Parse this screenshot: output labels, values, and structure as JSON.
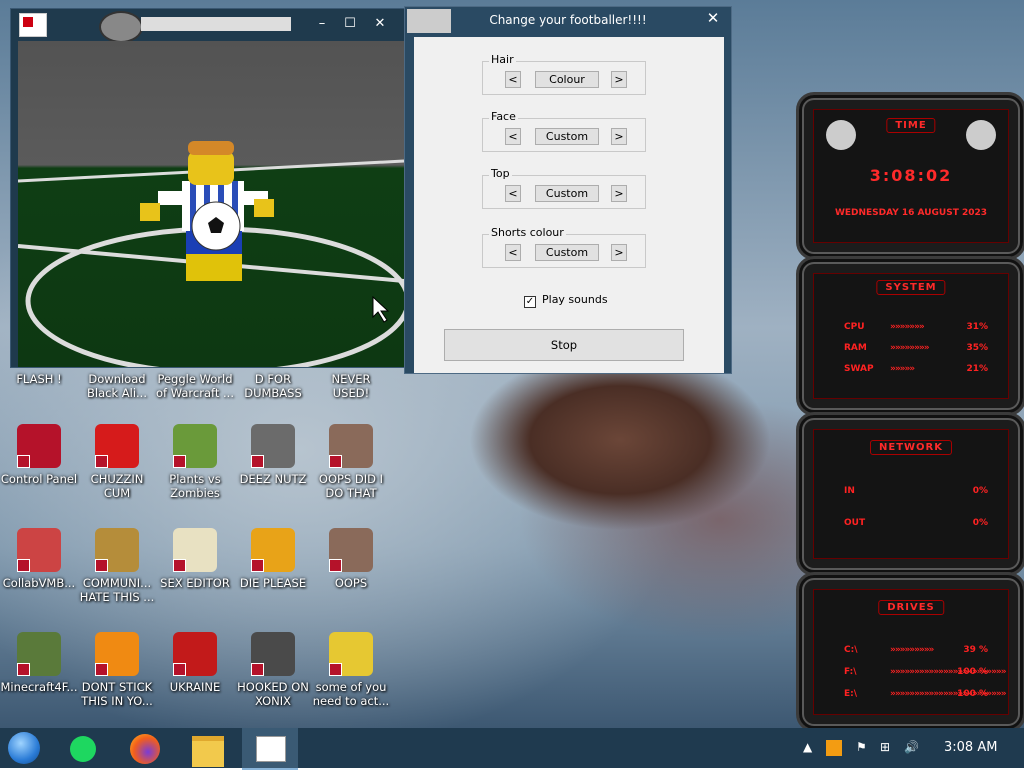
{
  "dialog": {
    "title": "Change your footballer!!!!",
    "groups": [
      {
        "label": "Hair",
        "value": "Colour"
      },
      {
        "label": "Face",
        "value": "Custom"
      },
      {
        "label": "Top",
        "value": "Custom"
      },
      {
        "label": "Shorts colour",
        "value": "Custom"
      }
    ],
    "prev_label": "<",
    "next_label": ">",
    "play_sounds": {
      "label": "Play sounds",
      "checked": true
    },
    "stop_label": "Stop"
  },
  "game_window": {
    "controls": {
      "minimize": "–",
      "maximize": "☐",
      "close": "✕"
    }
  },
  "desktop_icons": [
    {
      "label": "FLASH !",
      "icon": "flash-icon",
      "color": "#444"
    },
    {
      "label": "Download Black Ali...",
      "icon": "download-icon",
      "color": "#555"
    },
    {
      "label": "Peggle World of Warcraft ...",
      "icon": "peggle-icon",
      "color": "#666"
    },
    {
      "label": "D FOR DUMBASS",
      "icon": "d-icon",
      "color": "#777"
    },
    {
      "label": "NEVER USED!",
      "icon": "never-used-icon",
      "color": "#555"
    },
    {
      "label": "Control Panel",
      "icon": "control-panel-icon",
      "color": "#b5122a"
    },
    {
      "label": "CHUZZIN CUM",
      "icon": "chuzzle-icon",
      "color": "#d61b1b"
    },
    {
      "label": "Plants vs Zombies",
      "icon": "plants-vs-zombies-icon",
      "color": "#6a9a3a"
    },
    {
      "label": "DEEZ NUTZ",
      "icon": "stack-icon",
      "color": "#6b6b6b"
    },
    {
      "label": "OOPS DID I DO THAT",
      "icon": "portrait-icon",
      "color": "#8a6a5a"
    },
    {
      "label": "CollabVMB...",
      "icon": "monitor-icon",
      "color": "#c44"
    },
    {
      "label": "COMMUNI... HATE THIS ...",
      "icon": "money-bag-icon",
      "color": "#b58d3a"
    },
    {
      "label": "SEX EDITOR",
      "icon": "hxd-icon",
      "color": "#e8e1c2"
    },
    {
      "label": "DIE PLEASE",
      "icon": "de-icon",
      "color": "#e8a318"
    },
    {
      "label": "OOPS",
      "icon": "portrait-icon",
      "color": "#8a6a5a"
    },
    {
      "label": "Minecraft4F...",
      "icon": "minecraft-icon",
      "color": "#5a7a3a"
    },
    {
      "label": "DONT STICK THIS IN YO...",
      "icon": "vlc-icon",
      "color": "#f08a12"
    },
    {
      "label": "UKRAINE",
      "icon": "radiation-icon",
      "color": "#c21a1a"
    },
    {
      "label": "HOOKED ON XONIX",
      "icon": "xonix-icon",
      "color": "#4a4a4a"
    },
    {
      "label": "some of you need to act...",
      "icon": "dog-icon",
      "color": "#e6c832"
    }
  ],
  "gadget": {
    "time": {
      "header": "TIME",
      "clock": "3:08:02",
      "date": "WEDNESDAY 16 AUGUST 2023"
    },
    "system": {
      "header": "SYSTEM",
      "rows": [
        {
          "label": "CPU",
          "value": "31%",
          "level": 0.31
        },
        {
          "label": "RAM",
          "value": "35%",
          "level": 0.35
        },
        {
          "label": "SWAP",
          "value": "21%",
          "level": 0.21
        }
      ]
    },
    "network": {
      "header": "NETWORK",
      "rows": [
        {
          "label": "IN",
          "value": "0%"
        },
        {
          "label": "OUT",
          "value": "0%"
        }
      ]
    },
    "drives": {
      "header": "DRIVES",
      "rows": [
        {
          "label": "C:\\",
          "value": "39 %",
          "level": 0.39
        },
        {
          "label": "F:\\",
          "value": "100 %",
          "level": 1.0
        },
        {
          "label": "E:\\",
          "value": "100 %",
          "level": 1.0
        }
      ]
    }
  },
  "taskbar": {
    "clock": "3:08 AM",
    "pinned": [
      "start-orb-icon",
      "notes-icon",
      "firefox-icon",
      "file-explorer-icon",
      "game-app-icon"
    ]
  },
  "colors": {
    "accent_red": "#ff2222",
    "taskbar": "#1f3a4f",
    "dialog_bg": "#f0f0f0"
  }
}
